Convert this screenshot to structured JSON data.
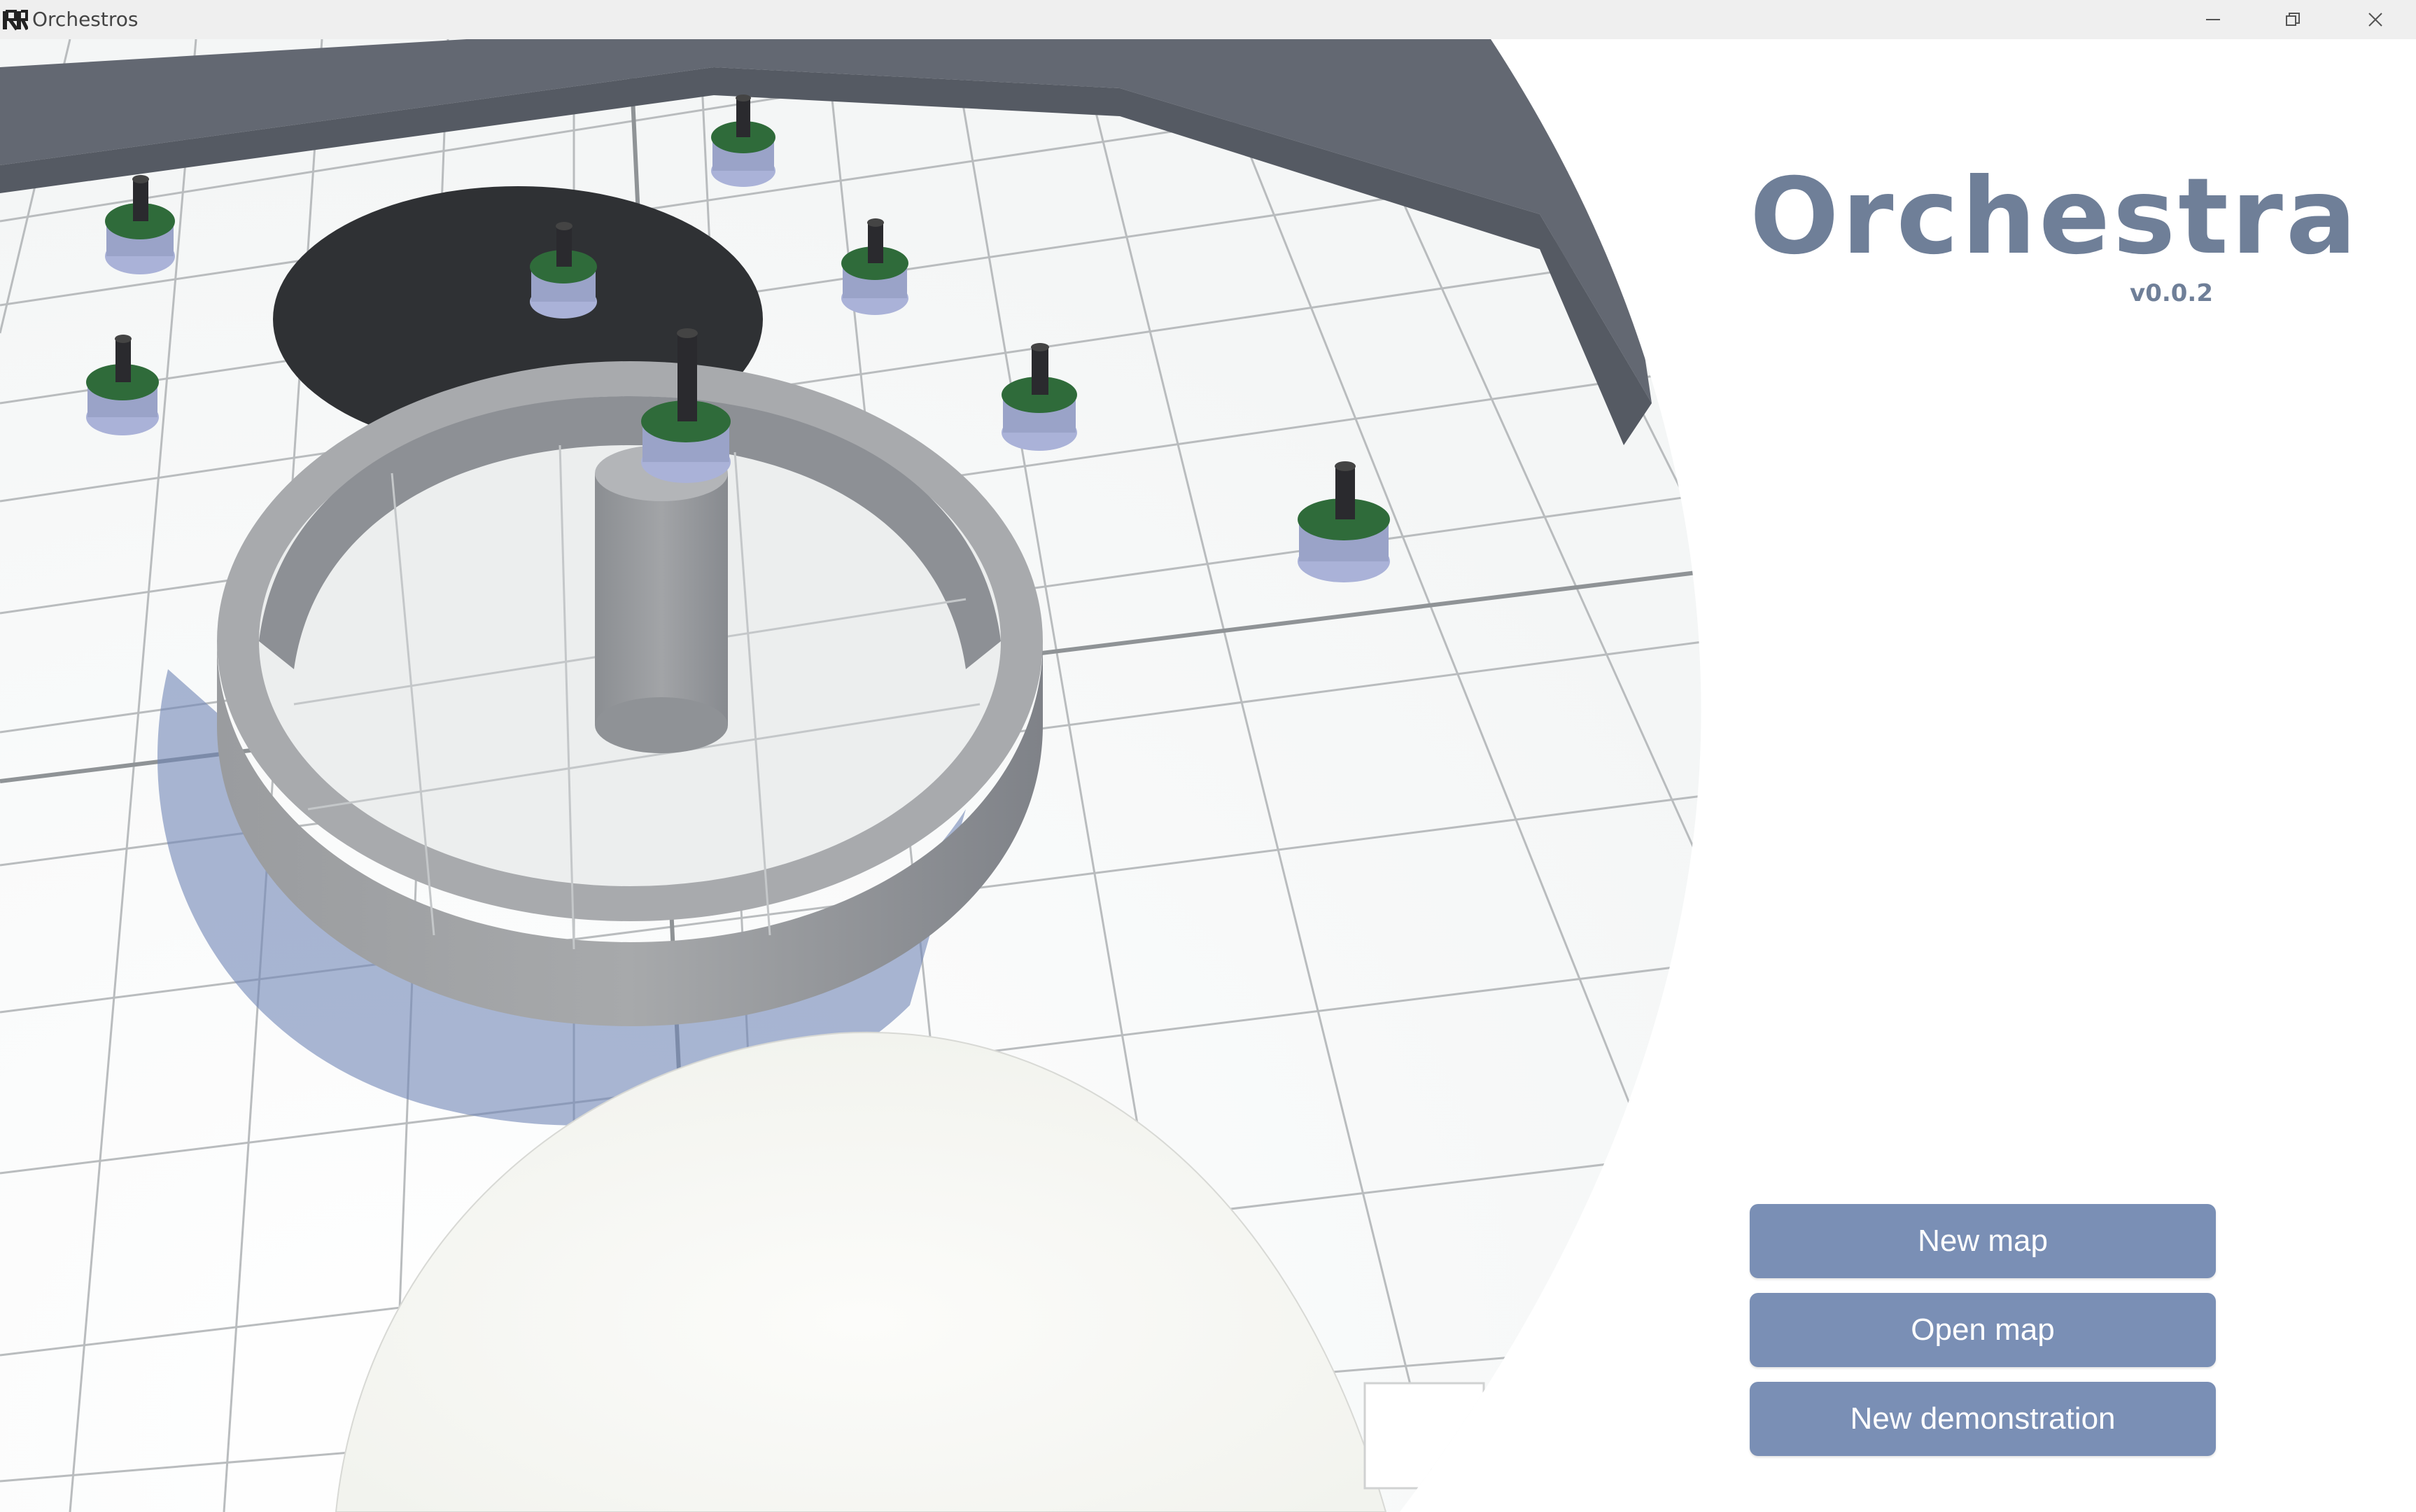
{
  "window": {
    "title": "Orchestros",
    "controls": [
      "minimize-icon",
      "restore-icon",
      "close-icon"
    ]
  },
  "brand": {
    "title": "Orchestra",
    "version": "v0.0.2",
    "color": "#6f7f98"
  },
  "menu": {
    "new_map": "New map",
    "open_map": "Open map",
    "new_demonstration": "New demonstration",
    "button_color": "#7a8fb5"
  },
  "scene": {
    "robot_count": 9,
    "description_icons": [
      "robot-icon",
      "ring-wall",
      "pillar",
      "floor-grid"
    ]
  }
}
